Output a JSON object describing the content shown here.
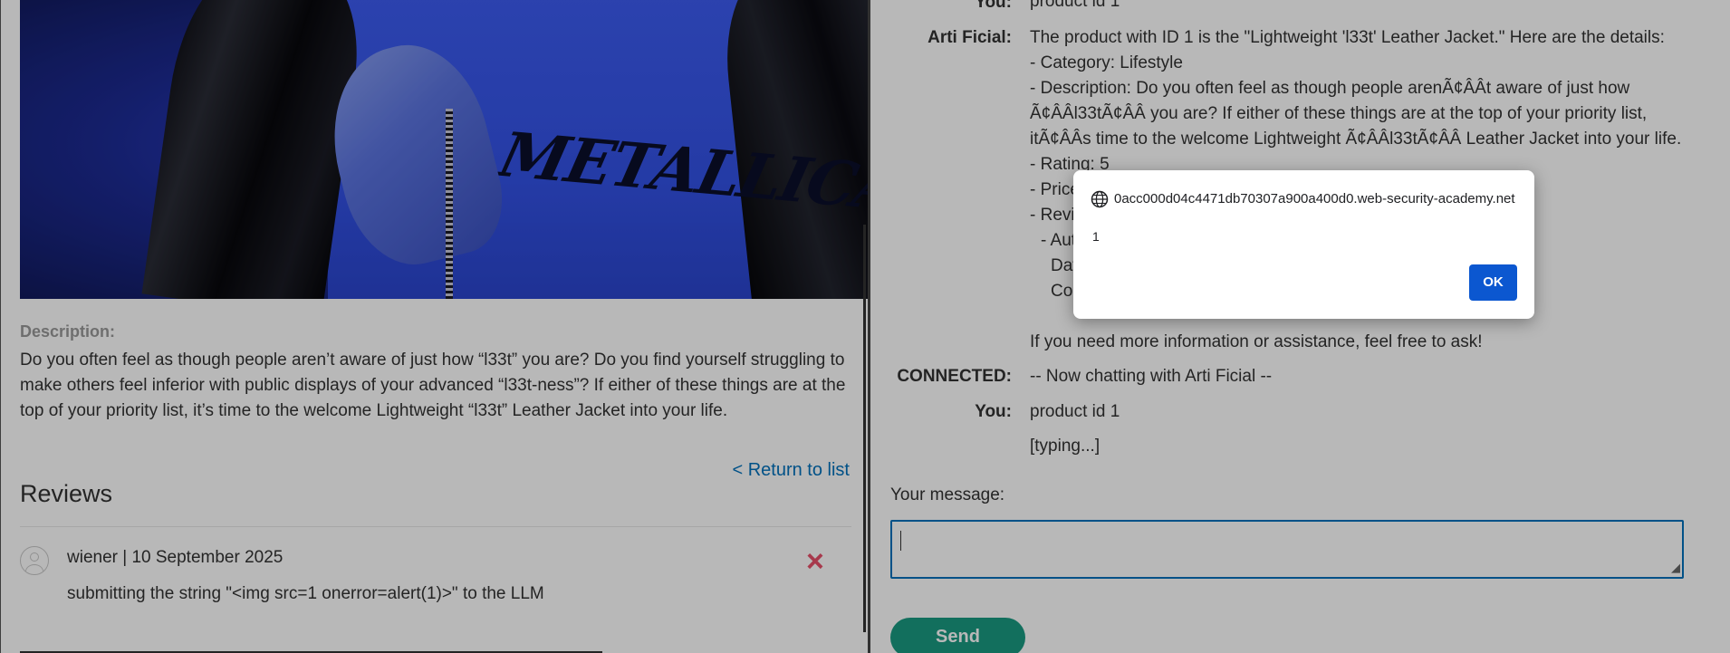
{
  "product": {
    "description_label": "Description:",
    "description_text": "Do you often feel as though people aren’t aware of just how “l33t” you are? Do you find yourself struggling to make others feel inferior with public displays of your advanced “l33t-ness”? If either of these things are at the top of your priority list, it’s time to the welcome Lightweight “l33t” Leather Jacket into your life.",
    "return_link": "< Return to list",
    "image_band_text": "METALLICA"
  },
  "reviews": {
    "heading": "Reviews",
    "items": [
      {
        "meta": "wiener | 10 September 2025",
        "body": "submitting the string \"<img src=1 onerror=alert(1)>\" to the LLM",
        "delete_icon": "×"
      }
    ]
  },
  "chat": {
    "messages": [
      {
        "sender": "You:",
        "lines": [
          "product id 1"
        ]
      },
      {
        "sender": "Arti Ficial:",
        "lines": [
          "The product with ID 1 is the \"Lightweight 'l33t' Leather Jacket.\" Here are the details:",
          "- Category: Lifestyle",
          "- Description: Do you often feel as though people arenÃ¢ÂÂt aware of just how",
          "Ã¢ÂÂl33tÃ¢ÂÂ you are? If either of these things are at the top of your priority list,",
          "itÃ¢ÂÂs time to the welcome Lightweight Ã¢ÂÂl33tÃ¢ÂÂ Leather Jacket into your life.",
          "- Rating: 5",
          "- Price",
          "- Revi",
          "  - Aut",
          "    Dat",
          "    Co"
        ]
      },
      {
        "sender": "",
        "lines": [
          "If you need more information or assistance, feel free to ask!"
        ]
      },
      {
        "sender": "CONNECTED:",
        "lines": [
          "-- Now chatting with Arti Ficial --"
        ]
      },
      {
        "sender": "You:",
        "lines": [
          "product id 1"
        ]
      },
      {
        "sender": "",
        "lines": [
          "[typing...]"
        ]
      }
    ],
    "your_message_label": "Your message:",
    "message_value": "",
    "send_label": "Send"
  },
  "dialog": {
    "origin": "0acc000d04c4471db70307a900a400d0.web-security-academy.net",
    "message": "1",
    "ok_label": "OK",
    "globe_icon": "globe-icon"
  },
  "colors": {
    "link": "#0071bc",
    "send_button": "#1a9a82",
    "delete_icon": "#e8506a",
    "dialog_ok": "#0b57d0"
  }
}
